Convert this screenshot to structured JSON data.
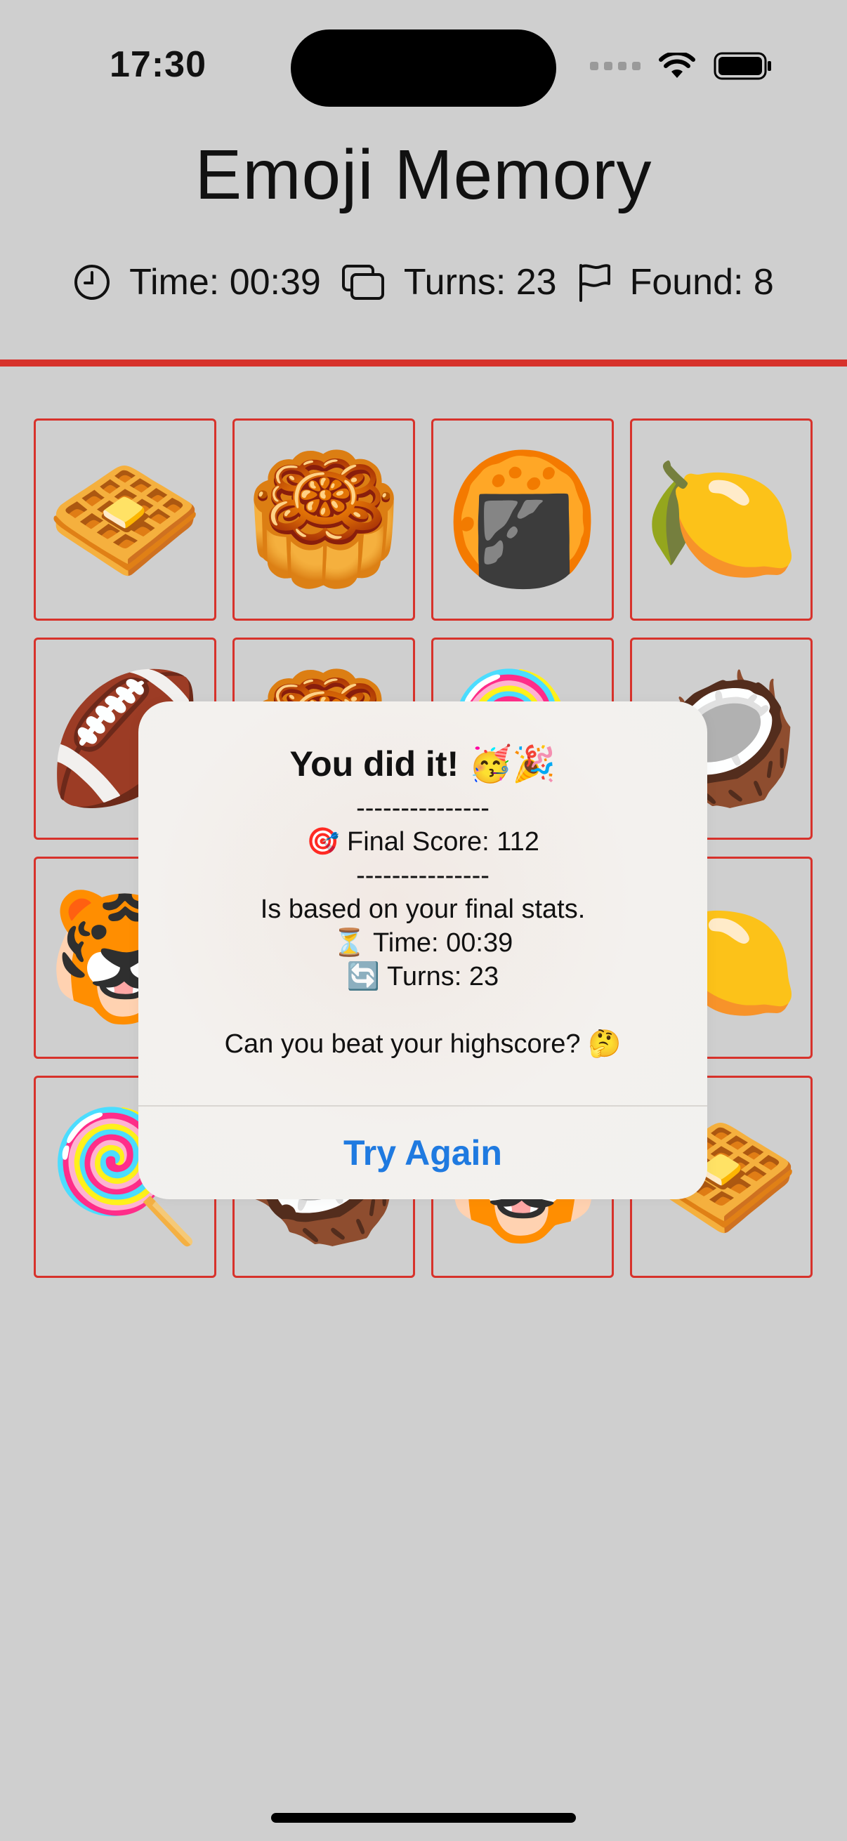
{
  "status_bar": {
    "time": "17:30",
    "icons": [
      "signal-dots-icon",
      "wifi-icon",
      "battery-icon"
    ]
  },
  "title": "Emoji Memory",
  "stats": {
    "time": "Time: 00:39",
    "turns": "Turns: 23",
    "found": "Found: 8",
    "icons": [
      "clock-icon",
      "cards-icon",
      "flag-icon"
    ]
  },
  "colors": {
    "accent_red": "#d7322b",
    "background": "#cfcfcf",
    "link_blue": "#1f7ae0"
  },
  "grid": {
    "cards": [
      "🧇",
      "🥮",
      "🍘",
      "🍋",
      "🏈",
      "🥮",
      "🍭",
      "🥥",
      "🐯",
      "🍘",
      "🏈",
      "🍋",
      "🍭",
      "🥥",
      "🐯",
      "🧇"
    ]
  },
  "alert": {
    "title": "You did it! 🥳🎉",
    "message": "---------------\n🎯 Final Score: 112\n---------------\nIs based on your final stats.\n⏳ Time: 00:39\n🔄 Turns: 23\n\nCan you beat your highscore? 🤔",
    "button": "Try Again"
  }
}
